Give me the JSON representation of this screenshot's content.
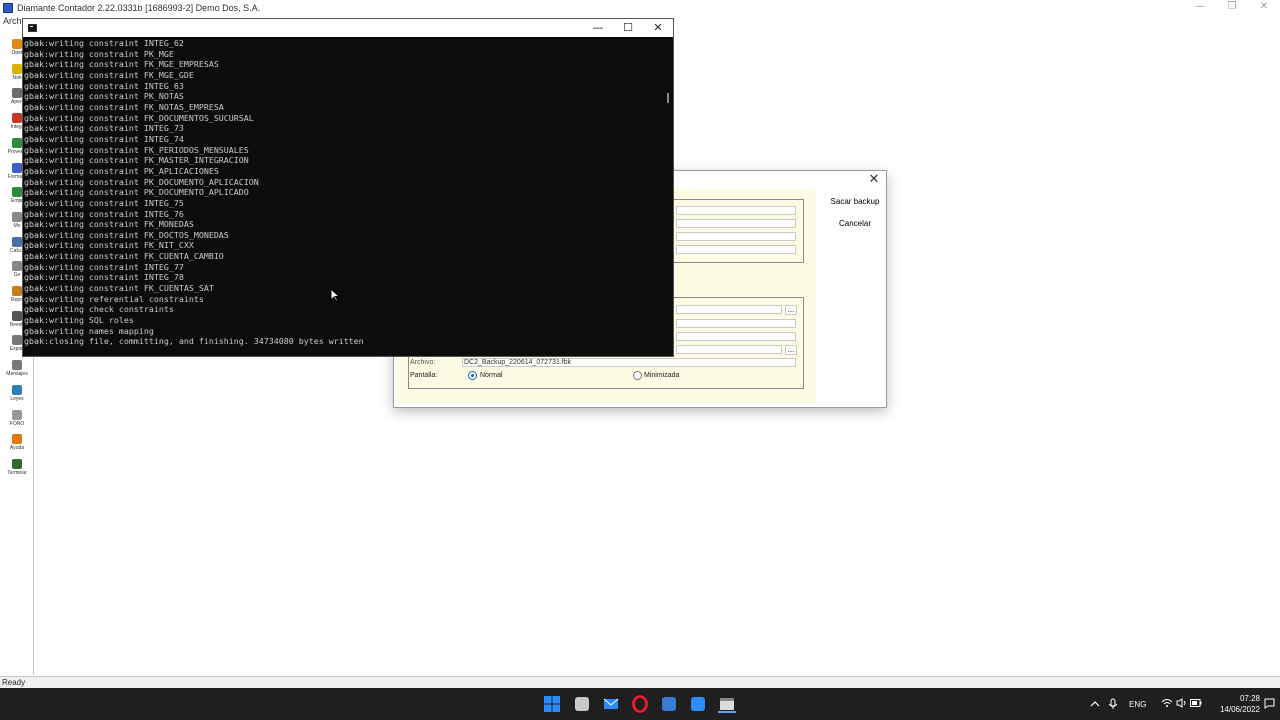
{
  "app": {
    "title": "Diamante Contador 2.22.0331b [1686993-2] Demo Dos, S.A.",
    "menu_first": "Arch",
    "status": "Ready",
    "window_controls": [
      "—",
      "❐",
      "✕"
    ]
  },
  "toolbar": {
    "items": [
      {
        "label": "Oper",
        "icon": "operations-icon",
        "color": "#e08a1e"
      },
      {
        "label": "Noti",
        "icon": "news-icon",
        "color": "#d9b300"
      },
      {
        "label": "Apert",
        "icon": "open-icon",
        "color": "#6d6d6d"
      },
      {
        "label": "Integr",
        "icon": "integration-icon",
        "color": "#c0392b"
      },
      {
        "label": "Proveed",
        "icon": "suppliers-icon",
        "color": "#2e8b3d"
      },
      {
        "label": "Formato",
        "icon": "format-icon",
        "color": "#3a5fcd"
      },
      {
        "label": "Empr",
        "icon": "company-icon",
        "color": "#2e8b3d"
      },
      {
        "label": "Mo",
        "icon": "module-icon",
        "color": "#888888"
      },
      {
        "label": "Calcul",
        "icon": "calculator-icon",
        "color": "#4a6fa5"
      },
      {
        "label": "Ge",
        "icon": "manage-icon",
        "color": "#888888"
      },
      {
        "label": "Repo",
        "icon": "reports-icon",
        "color": "#c77d1a"
      },
      {
        "label": "Reestr",
        "icon": "restructure-icon",
        "color": "#555555"
      },
      {
        "label": "Export",
        "icon": "export-icon",
        "color": "#777777"
      },
      {
        "label": "Mensajes",
        "icon": "messages-icon",
        "color": "#777777"
      },
      {
        "label": "Leyes",
        "icon": "laws-icon",
        "color": "#2f7fb0"
      },
      {
        "label": "FORO",
        "icon": "forum-icon",
        "color": "#999999"
      },
      {
        "label": "Ayuda",
        "icon": "help-icon",
        "color": "#e07b00"
      },
      {
        "label": "Terminar",
        "icon": "exit-icon",
        "color": "#2e6b2e"
      }
    ]
  },
  "console": {
    "controls": [
      "—",
      "☐",
      "✕"
    ],
    "lines": [
      "gbak:writing constraint INTEG_62",
      "gbak:writing constraint PK_MGE",
      "gbak:writing constraint FK_MGE_EMPRESAS",
      "gbak:writing constraint FK_MGE_GDE",
      "gbak:writing constraint INTEG_63",
      "gbak:writing constraint PK_NOTAS",
      "gbak:writing constraint FK_NOTAS_EMPRESA",
      "gbak:writing constraint FK_DOCUMENTOS_SUCURSAL",
      "gbak:writing constraint INTEG_73",
      "gbak:writing constraint INTEG_74",
      "gbak:writing constraint FK_PERIODOS_MENSUALES",
      "gbak:writing constraint FK_MASTER_INTEGRACION",
      "gbak:writing constraint PK_APLICACIONES",
      "gbak:writing constraint PK_DOCUMENTO_APLICACION",
      "gbak:writing constraint PK_DOCUMENTO_APLICADO",
      "gbak:writing constraint INTEG_75",
      "gbak:writing constraint INTEG_76",
      "gbak:writing constraint FK_MONEDAS",
      "gbak:writing constraint FK_DOCTOS_MONEDAS",
      "gbak:writing constraint FK_NIT_CXX",
      "gbak:writing constraint FK_CUENTA_CAMBIO",
      "gbak:writing constraint INTEG_77",
      "gbak:writing constraint INTEG_78",
      "gbak:writing constraint FK_CUENTAS_SAT",
      "gbak:writing referential constraints",
      "gbak:writing check constraints",
      "gbak:writing SQL roles",
      "gbak:writing names mapping",
      "gbak:closing file, committing, and finishing. 34734080 bytes written"
    ]
  },
  "dialog": {
    "close": "✕",
    "backup_button": "Sacar backup",
    "cancel_button": "Cancelar",
    "dots": "...",
    "file_label": "Archivo:",
    "file_value": "DC2_Backup_220614_072731.fbk",
    "screen_label": "Pantalla:",
    "option_normal": "Normal",
    "option_minimized": "Minimizada"
  },
  "taskbar": {
    "apps": [
      {
        "icon": "windows-start-icon",
        "color": "#2b8cff"
      },
      {
        "icon": "file-explorer-icon",
        "color": "#c9c9c9"
      },
      {
        "icon": "mail-icon",
        "color": "#2b8cff"
      },
      {
        "icon": "opera-icon",
        "color": "#ff1b2d"
      },
      {
        "icon": "diamante-app-icon",
        "color": "#3a7bd5"
      },
      {
        "icon": "zoom-icon",
        "color": "#2d8cff"
      },
      {
        "icon": "console-app-icon",
        "color": "#dddddd"
      }
    ],
    "language": "ENG",
    "time": "07:28",
    "date": "14/06/2022"
  }
}
